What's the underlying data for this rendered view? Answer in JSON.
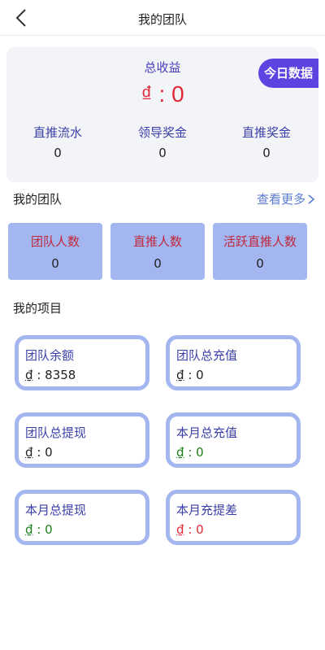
{
  "header": {
    "title": "我的团队"
  },
  "summary": {
    "total_label": "总收益",
    "total_value": "₫ : 0",
    "today_button": "今日数据",
    "stats": [
      {
        "label": "直推流水",
        "value": "0"
      },
      {
        "label": "领导奖金",
        "value": "0"
      },
      {
        "label": "直推奖金",
        "value": "0"
      }
    ]
  },
  "team_section": {
    "title": "我的团队",
    "more_label": "查看更多",
    "boxes": [
      {
        "label": "团队人数",
        "value": "0"
      },
      {
        "label": "直推人数",
        "value": "0"
      },
      {
        "label": "活跃直推人数",
        "value": "0"
      }
    ]
  },
  "projects_section": {
    "title": "我的项目",
    "currency": "₫",
    "cards": [
      {
        "label": "团队余额",
        "value": ": 8358"
      },
      {
        "label": "团队总充值",
        "value": ": 0"
      },
      {
        "label": "团队总提现",
        "value": ": 0"
      },
      {
        "label": "本月总充值",
        "value": ": 0"
      },
      {
        "label": "本月总提现",
        "value": ": 0"
      },
      {
        "label": "本月充提差",
        "value": ": 0"
      }
    ]
  },
  "colors": {
    "accent": "#5b44e0",
    "box": "#a4b6f0",
    "red": "#e0283a",
    "green": "#1a7f1a",
    "label_blue": "#3b3fa8"
  },
  "icons": {
    "back": "chevron-left-icon",
    "more": "chevron-right-icon"
  }
}
